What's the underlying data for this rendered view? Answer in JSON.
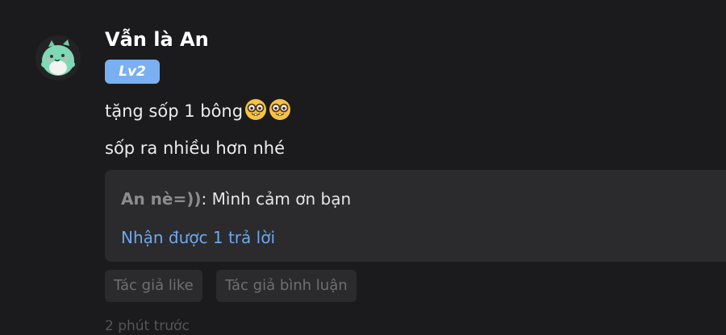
{
  "comment": {
    "username": "Vẫn là An",
    "level": "Lv2",
    "lines": [
      "tặng sốp 1 bông",
      "sốp ra nhiều hơn nhé"
    ],
    "emojis": [
      "nerd-face-emoji",
      "nerd-face-emoji"
    ],
    "reply": {
      "author": "An nè=))",
      "separator": ": ",
      "text": "Mình cảm ơn bạn",
      "count_label": "Nhận được 1 trả lời"
    },
    "tags": [
      "Tác giả like",
      "Tác giả bình luận"
    ],
    "timestamp": "2 phút trước"
  },
  "colors": {
    "background": "#1b1b1d",
    "badge": "#7ab0f2",
    "reply_box": "#2b2b2d",
    "link": "#6fa7ee",
    "avatar": "#7fd9b6"
  }
}
